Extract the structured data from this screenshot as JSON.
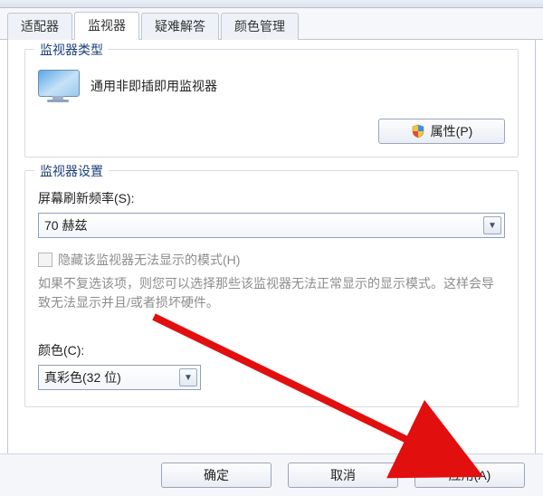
{
  "tabs": {
    "adapter": "适配器",
    "monitor": "监视器",
    "troubleshoot": "疑难解答",
    "colorMgmt": "颜色管理"
  },
  "group_monitor_type": {
    "title": "监视器类型",
    "device_name": "通用非即插即用监视器",
    "properties_btn": "属性(P)"
  },
  "group_monitor_settings": {
    "title": "监视器设置",
    "refresh_label": "屏幕刷新频率(S):",
    "refresh_value": "70 赫兹",
    "hide_modes_checkbox": "隐藏该监视器无法显示的模式(H)",
    "hide_modes_hint": "如果不复选该项，则您可以选择那些该监视器无法正常显示的显示模式。这样会导致无法显示并且/或者损坏硬件。",
    "color_label": "颜色(C):",
    "color_value": "真彩色(32 位)"
  },
  "footer": {
    "ok": "确定",
    "cancel": "取消",
    "apply": "应用(A)"
  }
}
